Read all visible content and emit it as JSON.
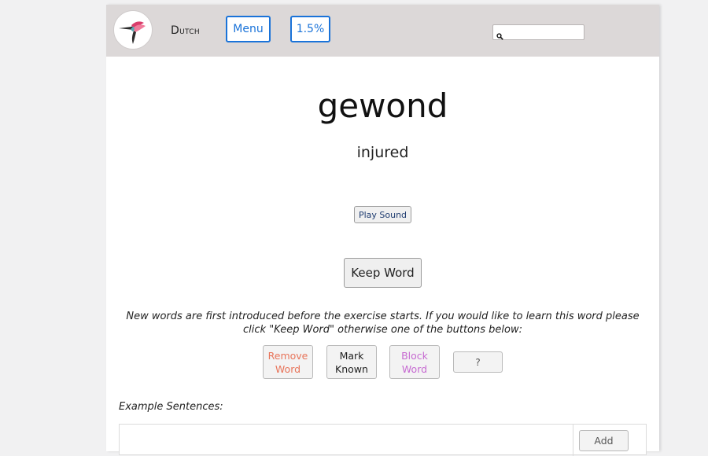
{
  "header": {
    "language_first": "D",
    "language_rest": "utch",
    "menu_label": "Menu",
    "progress_label": "1.5%",
    "search_placeholder": "",
    "search_icon": "search-icon",
    "logo_icon": "hummingbird-logo"
  },
  "card": {
    "word": "gewond",
    "translation": "injured",
    "play_sound_label": "Play Sound",
    "keep_word_label": "Keep Word",
    "note": "New words are first introduced before the exercise starts. If you would like to learn this word please click \"Keep Word\" otherwise one of the buttons below:"
  },
  "actions": {
    "remove_line1": "Remove",
    "remove_line2": "Word",
    "known_line1": "Mark",
    "known_line2": "Known",
    "block_line1": "Block",
    "block_line2": "Word",
    "question_label": "?"
  },
  "examples": {
    "label": "Example Sentences:",
    "add_label": "Add"
  },
  "colors": {
    "header_bg": "#dcd8d8",
    "accent_blue": "#1a73d9",
    "remove_red": "#e8745a",
    "block_purple": "#c66ad1"
  }
}
